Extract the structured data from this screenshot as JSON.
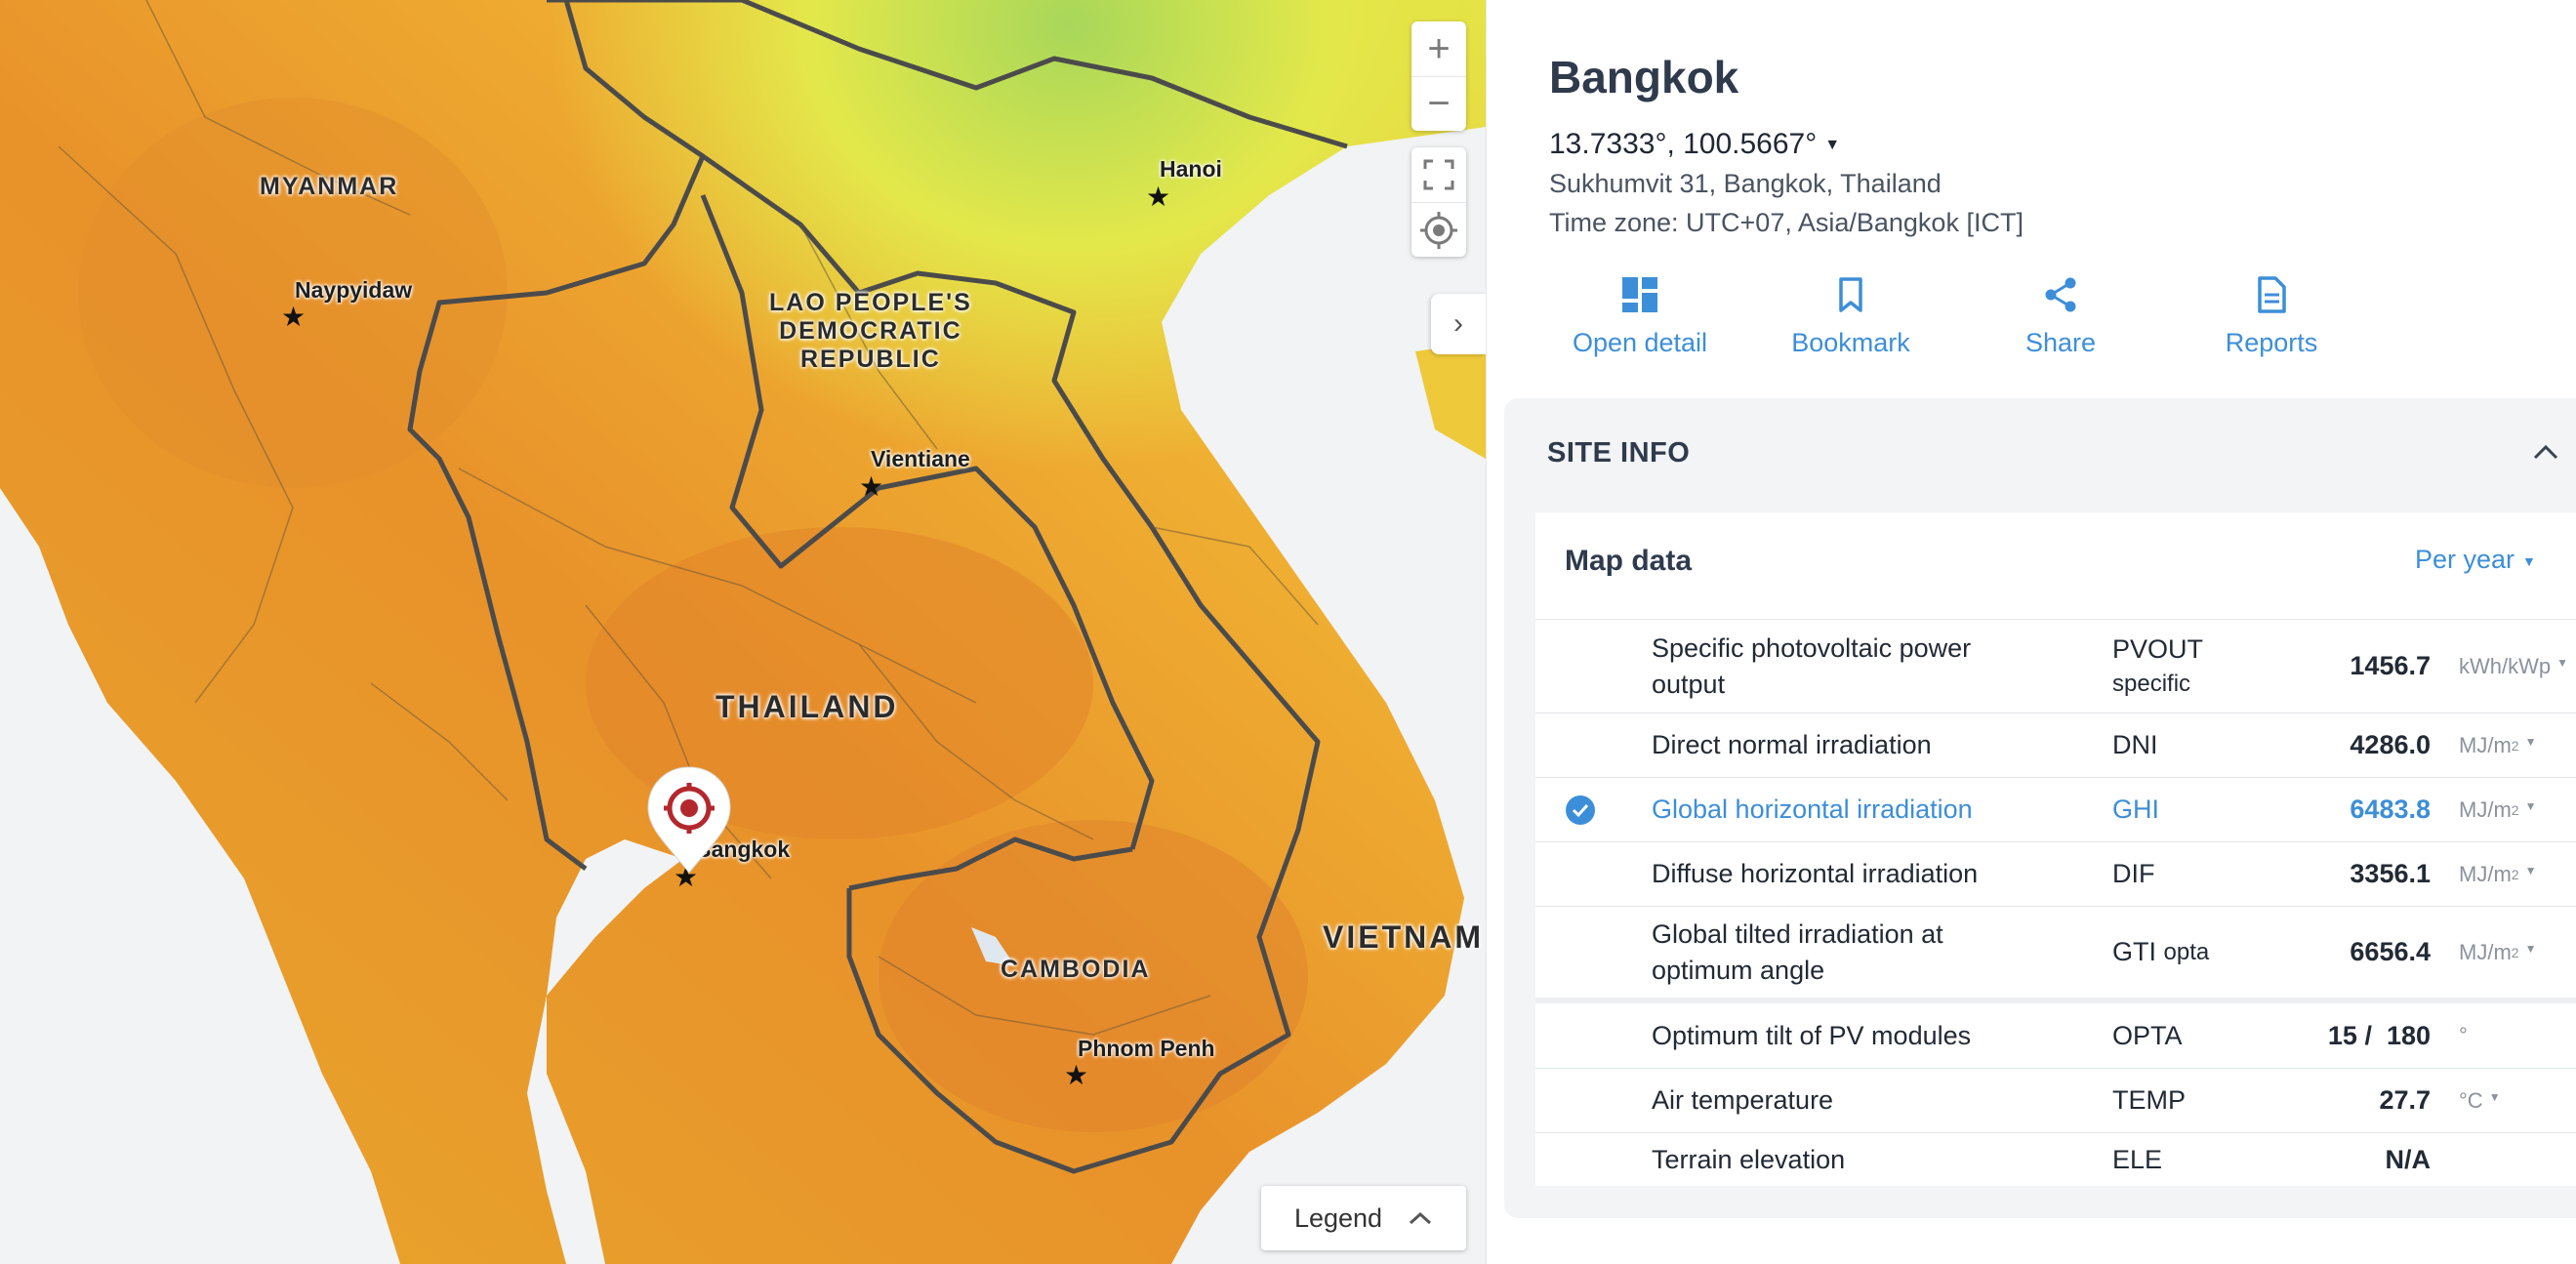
{
  "map": {
    "countries": [
      "MYANMAR",
      "LAO PEOPLE'S\nDEMOCRATIC\nREPUBLIC",
      "THAILAND",
      "CAMBODIA",
      "VIETNAM"
    ],
    "cities": [
      "Naypyidaw",
      "Hanoi",
      "Vientiane",
      "Bangkok",
      "Phnom Penh"
    ],
    "controls": {
      "zoom_in": "+",
      "zoom_out": "−",
      "expand_arrow": "›"
    },
    "legend_label": "Legend"
  },
  "panel": {
    "title": "Bangkok",
    "coordinates": "13.7333°, 100.5667°",
    "address": "Sukhumvit 31, Bangkok, Thailand",
    "timezone": "Time zone: UTC+07, Asia/Bangkok [ICT]",
    "actions": [
      {
        "label": "Open detail",
        "icon": "dashboard-icon"
      },
      {
        "label": "Bookmark",
        "icon": "bookmark-icon"
      },
      {
        "label": "Share",
        "icon": "share-icon"
      },
      {
        "label": "Reports",
        "icon": "document-icon"
      }
    ],
    "section_title": "SITE INFO",
    "card_title": "Map data",
    "period": "Per year",
    "rows": [
      {
        "name": "Specific photovoltaic power output",
        "abbr": "PVOUT",
        "abbr_sub": "specific",
        "value": "1456.7",
        "unit": "kWh/kWp"
      },
      {
        "name": "Direct normal irradiation",
        "abbr": "DNI",
        "abbr_sub": "",
        "value": "4286.0",
        "unit": "MJ/m",
        "unit_sup": "2"
      },
      {
        "name": "Global horizontal irradiation",
        "abbr": "GHI",
        "abbr_sub": "",
        "value": "6483.8",
        "unit": "MJ/m",
        "unit_sup": "2",
        "selected": true
      },
      {
        "name": "Diffuse horizontal irradiation",
        "abbr": "DIF",
        "abbr_sub": "",
        "value": "3356.1",
        "unit": "MJ/m",
        "unit_sup": "2"
      },
      {
        "name": "Global tilted irradiation at optimum angle",
        "abbr": "GTI",
        "abbr_sub": "opta",
        "value": "6656.4",
        "unit": "MJ/m",
        "unit_sup": "2"
      },
      {
        "name": "Optimum tilt of PV modules",
        "abbr": "OPTA",
        "abbr_sub": "",
        "value": "15 /  180",
        "unit": "°"
      },
      {
        "name": "Air temperature",
        "abbr": "TEMP",
        "abbr_sub": "",
        "value": "27.7",
        "unit": "°C"
      },
      {
        "name": "Terrain elevation",
        "abbr": "ELE",
        "abbr_sub": "",
        "value": "N/A",
        "unit": ""
      }
    ],
    "colors": {
      "accent": "#3d8ed8",
      "title": "#2f3b4c",
      "section_bg": "#f2f4f6"
    }
  }
}
